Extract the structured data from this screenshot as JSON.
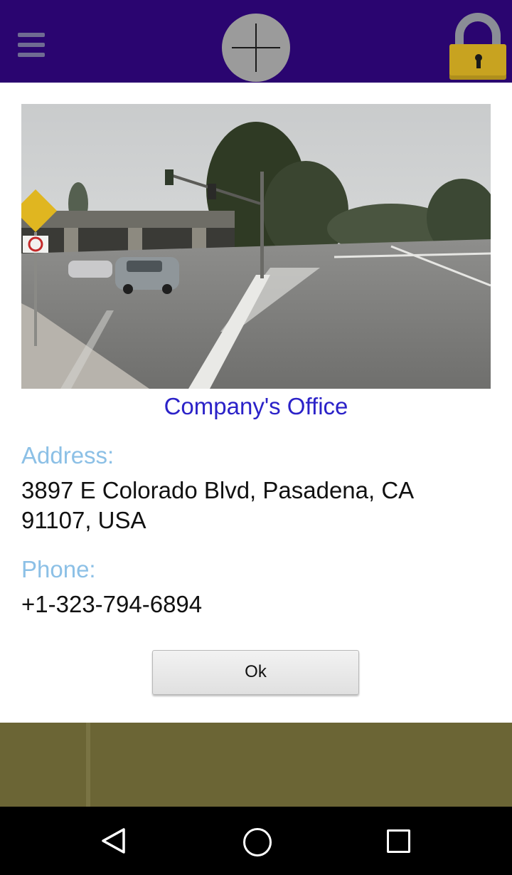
{
  "toolbar": {
    "menu_icon": "hamburger-menu-icon",
    "add_icon": "plus-icon",
    "lock_icon": "padlock-icon"
  },
  "location": {
    "name": "Company's Office",
    "address_label": "Address:",
    "address": "3897 E Colorado Blvd, Pasadena, CA 91107, USA",
    "phone_label": "Phone:",
    "phone": "+1-323-794-6894"
  },
  "dialog": {
    "ok_label": "Ok"
  },
  "colors": {
    "topbar": "#2a0570",
    "title": "#2b22c8",
    "label": "#8cc0e6",
    "map": "#6b6535"
  },
  "system_nav": {
    "back_icon": "back-triangle-icon",
    "home_icon": "home-circle-icon",
    "recents_icon": "recents-square-icon"
  }
}
